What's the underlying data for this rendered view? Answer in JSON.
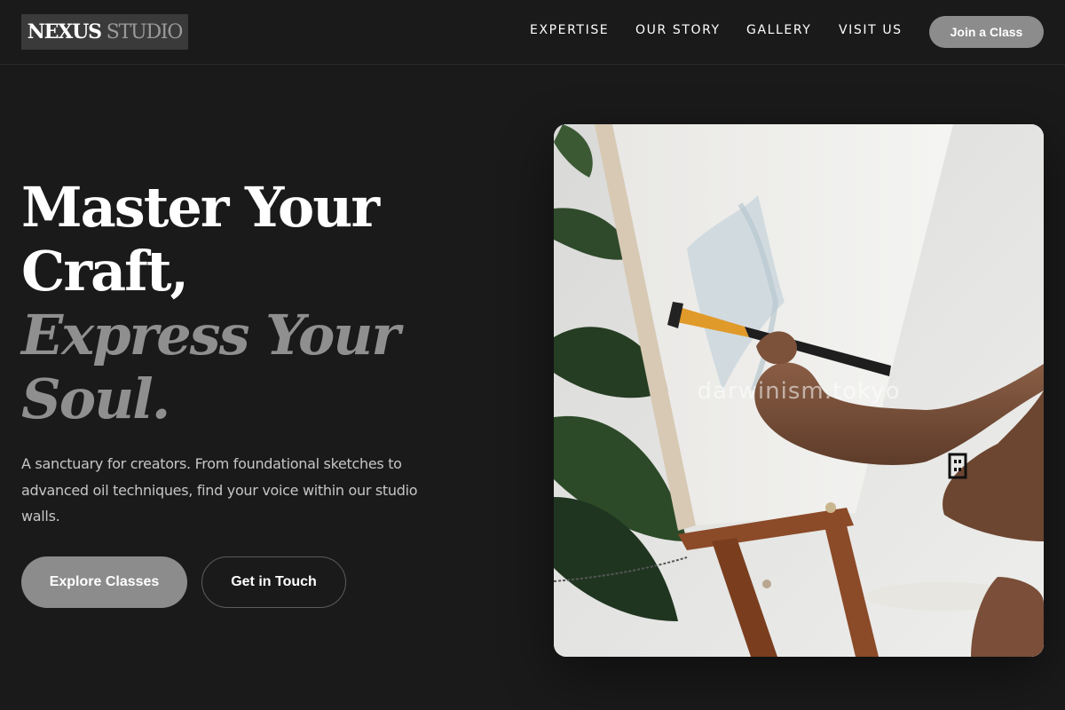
{
  "brand": {
    "name_strong": "NEXUS",
    "name_light": "STUDIO"
  },
  "nav": {
    "items": [
      {
        "label": "EXPERTISE"
      },
      {
        "label": "OUR STORY"
      },
      {
        "label": "GALLERY"
      },
      {
        "label": "VISIT US"
      }
    ],
    "cta_label": "Join a Class"
  },
  "hero": {
    "headline_line1": "Master Your",
    "headline_line2": "Craft,",
    "headline_line3": "Express Your",
    "headline_line4": "Soul.",
    "description": "A sanctuary for creators. From foundational sketches to advanced oil techniques, find your voice within our studio walls.",
    "primary_button": "Explore Classes",
    "secondary_button": "Get in Touch",
    "image_watermark": "darwinism.tokyo"
  },
  "colors": {
    "background": "#1a1a1a",
    "accent_button": "#8c8c8c",
    "muted_heading": "#8f8f8f"
  }
}
